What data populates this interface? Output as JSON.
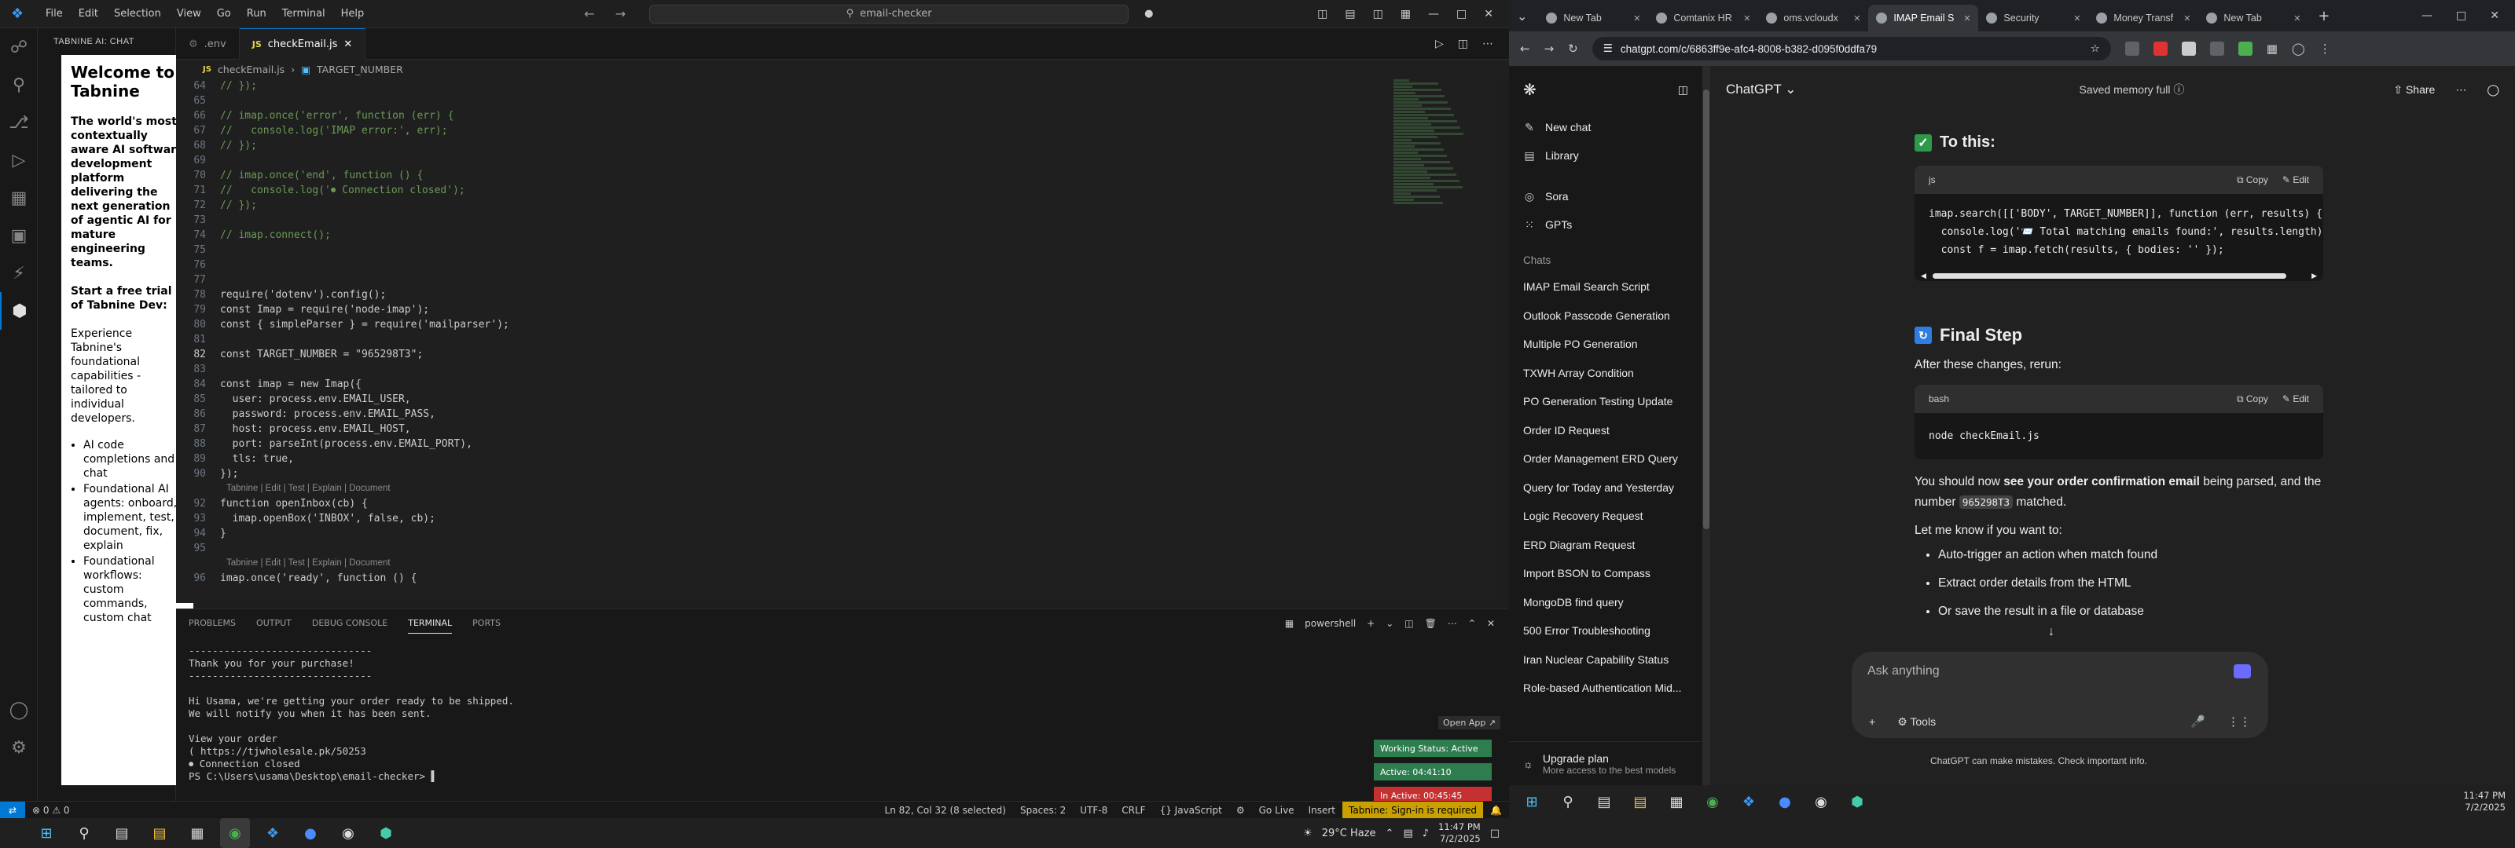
{
  "vscode": {
    "menu": [
      "File",
      "Edit",
      "Selection",
      "View",
      "Go",
      "Run",
      "Terminal",
      "Help"
    ],
    "command_center": "email-checker",
    "sidebar_title": "TABNINE AI: CHAT",
    "tabnine": {
      "heading": "Welcome to Tabnine",
      "tagline": "The world's most contextually aware AI software development platform delivering the next generation of agentic AI for mature engineering teams.",
      "trial": "Start a free trial of Tabnine Dev:",
      "intro": "Experience Tabnine's foundational capabilities - tailored to individual developers.",
      "bullets": [
        "AI code completions and chat",
        "Foundational AI agents: onboard, implement, test, document, fix, explain",
        "Foundational workflows: custom commands, custom chat"
      ]
    },
    "tabs": [
      {
        "label": ".env",
        "active": false
      },
      {
        "label": "checkEmail.js",
        "active": true
      }
    ],
    "breadcrumb": {
      "file": "checkEmail.js",
      "symbol": "TARGET_NUMBER"
    },
    "lens": "Tabnine | Edit | Test | Explain | Document",
    "code_lines": [
      {
        "n": "64",
        "t": "// });",
        "k": "cm"
      },
      {
        "n": "65",
        "t": "",
        "k": "pl"
      },
      {
        "n": "66",
        "t": "// imap.once('error', function (err) {",
        "k": "cm"
      },
      {
        "n": "67",
        "t": "//   console.log('IMAP error:', err);",
        "k": "cm"
      },
      {
        "n": "68",
        "t": "// });",
        "k": "cm"
      },
      {
        "n": "69",
        "t": "",
        "k": "pl"
      },
      {
        "n": "70",
        "t": "// imap.once('end', function () {",
        "k": "cm"
      },
      {
        "n": "71",
        "t": "//   console.log('⏺ Connection closed');",
        "k": "cm"
      },
      {
        "n": "72",
        "t": "// });",
        "k": "cm"
      },
      {
        "n": "73",
        "t": "",
        "k": "pl"
      },
      {
        "n": "74",
        "t": "// imap.connect();",
        "k": "cm"
      },
      {
        "n": "75",
        "t": "",
        "k": "pl"
      },
      {
        "n": "76",
        "t": "",
        "k": "pl"
      },
      {
        "n": "77",
        "t": "",
        "k": "pl"
      },
      {
        "n": "78",
        "t": "require('dotenv').config();",
        "k": "pl"
      },
      {
        "n": "79",
        "t": "const Imap = require('node-imap');",
        "k": "pl"
      },
      {
        "n": "80",
        "t": "const { simpleParser } = require('mailparser');",
        "k": "pl"
      },
      {
        "n": "81",
        "t": "",
        "k": "pl"
      },
      {
        "n": "82",
        "t": "const TARGET_NUMBER = \"965298T3\";",
        "k": "pl",
        "cur": true
      },
      {
        "n": "83",
        "t": "",
        "k": "pl"
      },
      {
        "n": "84",
        "t": "const imap = new Imap({",
        "k": "pl"
      },
      {
        "n": "85",
        "t": "  user: process.env.EMAIL_USER,",
        "k": "pl"
      },
      {
        "n": "86",
        "t": "  password: process.env.EMAIL_PASS,",
        "k": "pl"
      },
      {
        "n": "87",
        "t": "  host: process.env.EMAIL_HOST,",
        "k": "pl"
      },
      {
        "n": "88",
        "t": "  port: parseInt(process.env.EMAIL_PORT),",
        "k": "pl"
      },
      {
        "n": "89",
        "t": "  tls: true,",
        "k": "pl"
      },
      {
        "n": "90",
        "t": "});",
        "k": "pl"
      },
      {
        "n": "",
        "t": "Tabnine | Edit | Test | Explain | Document",
        "k": "lens"
      },
      {
        "n": "92",
        "t": "function openInbox(cb) {",
        "k": "pl"
      },
      {
        "n": "93",
        "t": "  imap.openBox('INBOX', false, cb);",
        "k": "pl"
      },
      {
        "n": "94",
        "t": "}",
        "k": "pl"
      },
      {
        "n": "95",
        "t": "",
        "k": "pl"
      },
      {
        "n": "",
        "t": "Tabnine | Edit | Test | Explain | Document",
        "k": "lens"
      },
      {
        "n": "96",
        "t": "imap.once('ready', function () {",
        "k": "pl"
      }
    ],
    "panel_tabs": [
      "PROBLEMS",
      "OUTPUT",
      "DEBUG CONSOLE",
      "TERMINAL",
      "PORTS"
    ],
    "terminal_shell": "powershell",
    "terminal_lines": [
      "-------------------------------",
      "Thank you for your purchase!",
      "-------------------------------",
      "",
      "Hi Usama, we're getting your order ready to be shipped.",
      "We will notify you when it has been sent.",
      "",
      "View your order",
      "( https://tjwholesale.pk/50253",
      "⏺ Connection closed",
      "PS C:\\Users\\usama\\Desktop\\email-checker> ▌"
    ],
    "open_app": "Open App ↗",
    "badges": [
      "Working Status: Active",
      "Active: 04:41:10",
      "In Active: 00:45:45"
    ],
    "status": {
      "errors": "⊗ 0 ⚠ 0",
      "position": "Ln 82, Col 32 (8 selected)",
      "spaces": "Spaces: 2",
      "encoding": "UTF-8",
      "eol": "CRLF",
      "language": "{} JavaScript",
      "golive": "Go Live",
      "insert": "Insert",
      "tabnine": "Tabnine: Sign-in is required"
    }
  },
  "taskbar": {
    "weather": "29°C  Haze",
    "time": "11:47 PM",
    "date": "7/2/2025"
  },
  "chrome": {
    "tabs": [
      {
        "label": "New Tab",
        "active": false
      },
      {
        "label": "Comtanix HR",
        "active": false
      },
      {
        "label": "oms.vcloudx",
        "active": false
      },
      {
        "label": "IMAP Email S",
        "active": true
      },
      {
        "label": "Security",
        "active": false
      },
      {
        "label": "Money Transf",
        "active": false
      },
      {
        "label": "New Tab",
        "active": false
      }
    ],
    "url": "chatgpt.com/c/6863ff9e-afc4-8008-b382-d095f0ddfa79"
  },
  "chatgpt": {
    "nav": [
      {
        "icon": "✎",
        "label": "New chat"
      },
      {
        "icon": "▤",
        "label": "Library"
      },
      {
        "icon": "◎",
        "label": "Sora"
      },
      {
        "icon": "⁙",
        "label": "GPTs"
      }
    ],
    "chats_header": "Chats",
    "chats": [
      "IMAP Email Search Script",
      "Outlook Passcode Generation",
      "Multiple PO Generation",
      "TXWH Array Condition",
      "PO Generation Testing Update",
      "Order ID Request",
      "Order Management ERD Query",
      "Query for Today and Yesterday",
      "Logic Recovery Request",
      "ERD Diagram Request",
      "Import BSON to Compass",
      "MongoDB find query",
      "500 Error Troubleshooting",
      "Iran Nuclear Capability Status",
      "Role-based Authentication Mid..."
    ],
    "upgrade_title": "Upgrade plan",
    "upgrade_sub": "More access to the best models",
    "model": "ChatGPT ⌄",
    "memory": "Saved memory full ⓘ",
    "share": "Share",
    "to_this": "To this:",
    "code1_lang": "js",
    "copy": "Copy",
    "edit": "Edit",
    "code1": "imap.search([['BODY', TARGET_NUMBER]], function (err, results) {\n  console.log('📨 Total matching emails found:', results.length)\n  const f = imap.fetch(results, { bodies: '' });",
    "final_step": "Final Step",
    "after": "After these changes, rerun:",
    "code2_lang": "bash",
    "code2": "node checkEmail.js",
    "should_pre": "You should now ",
    "should_bold": "see your order confirmation email",
    "should_post": " being parsed, and the number ",
    "should_code": "965298T3",
    "should_end": " matched.",
    "let_me": "Let me know if you want to:",
    "options": [
      "Auto-trigger an action when match found",
      "Extract order details from the HTML",
      "Or save the result in a file or database"
    ],
    "placeholder": "Ask anything",
    "tools": "Tools",
    "disclaimer": "ChatGPT can make mistakes. Check important info."
  }
}
